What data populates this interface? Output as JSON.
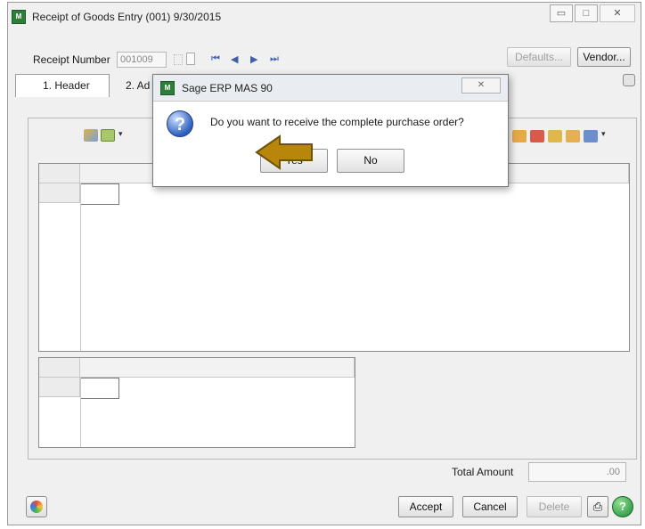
{
  "window": {
    "title": "Receipt of Goods Entry (001) 9/30/2015",
    "app_icon_text": "M",
    "minimize_glyph": "▭",
    "maximize_glyph": "□",
    "close_glyph": "✕"
  },
  "header": {
    "receipt_number_label": "Receipt Number",
    "receipt_number_value": "001009",
    "defaults_button": "Defaults...",
    "vendor_button": "Vendor..."
  },
  "tabs": [
    {
      "label": "1. Header"
    },
    {
      "label": "2. Ad"
    }
  ],
  "footer": {
    "total_amount_label": "Total Amount",
    "total_amount_value": ".00",
    "accept_button": "Accept",
    "cancel_button": "Cancel",
    "delete_button": "Delete"
  },
  "dialog": {
    "title": "Sage ERP MAS 90",
    "message": "Do you want to receive the complete purchase order?",
    "yes_button": "Yes",
    "no_button": "No",
    "close_glyph": "✕",
    "icon_glyph": "?"
  },
  "colors": {
    "annotation_arrow": "#b8860b",
    "dialog_icon": "#2c5fbf"
  }
}
